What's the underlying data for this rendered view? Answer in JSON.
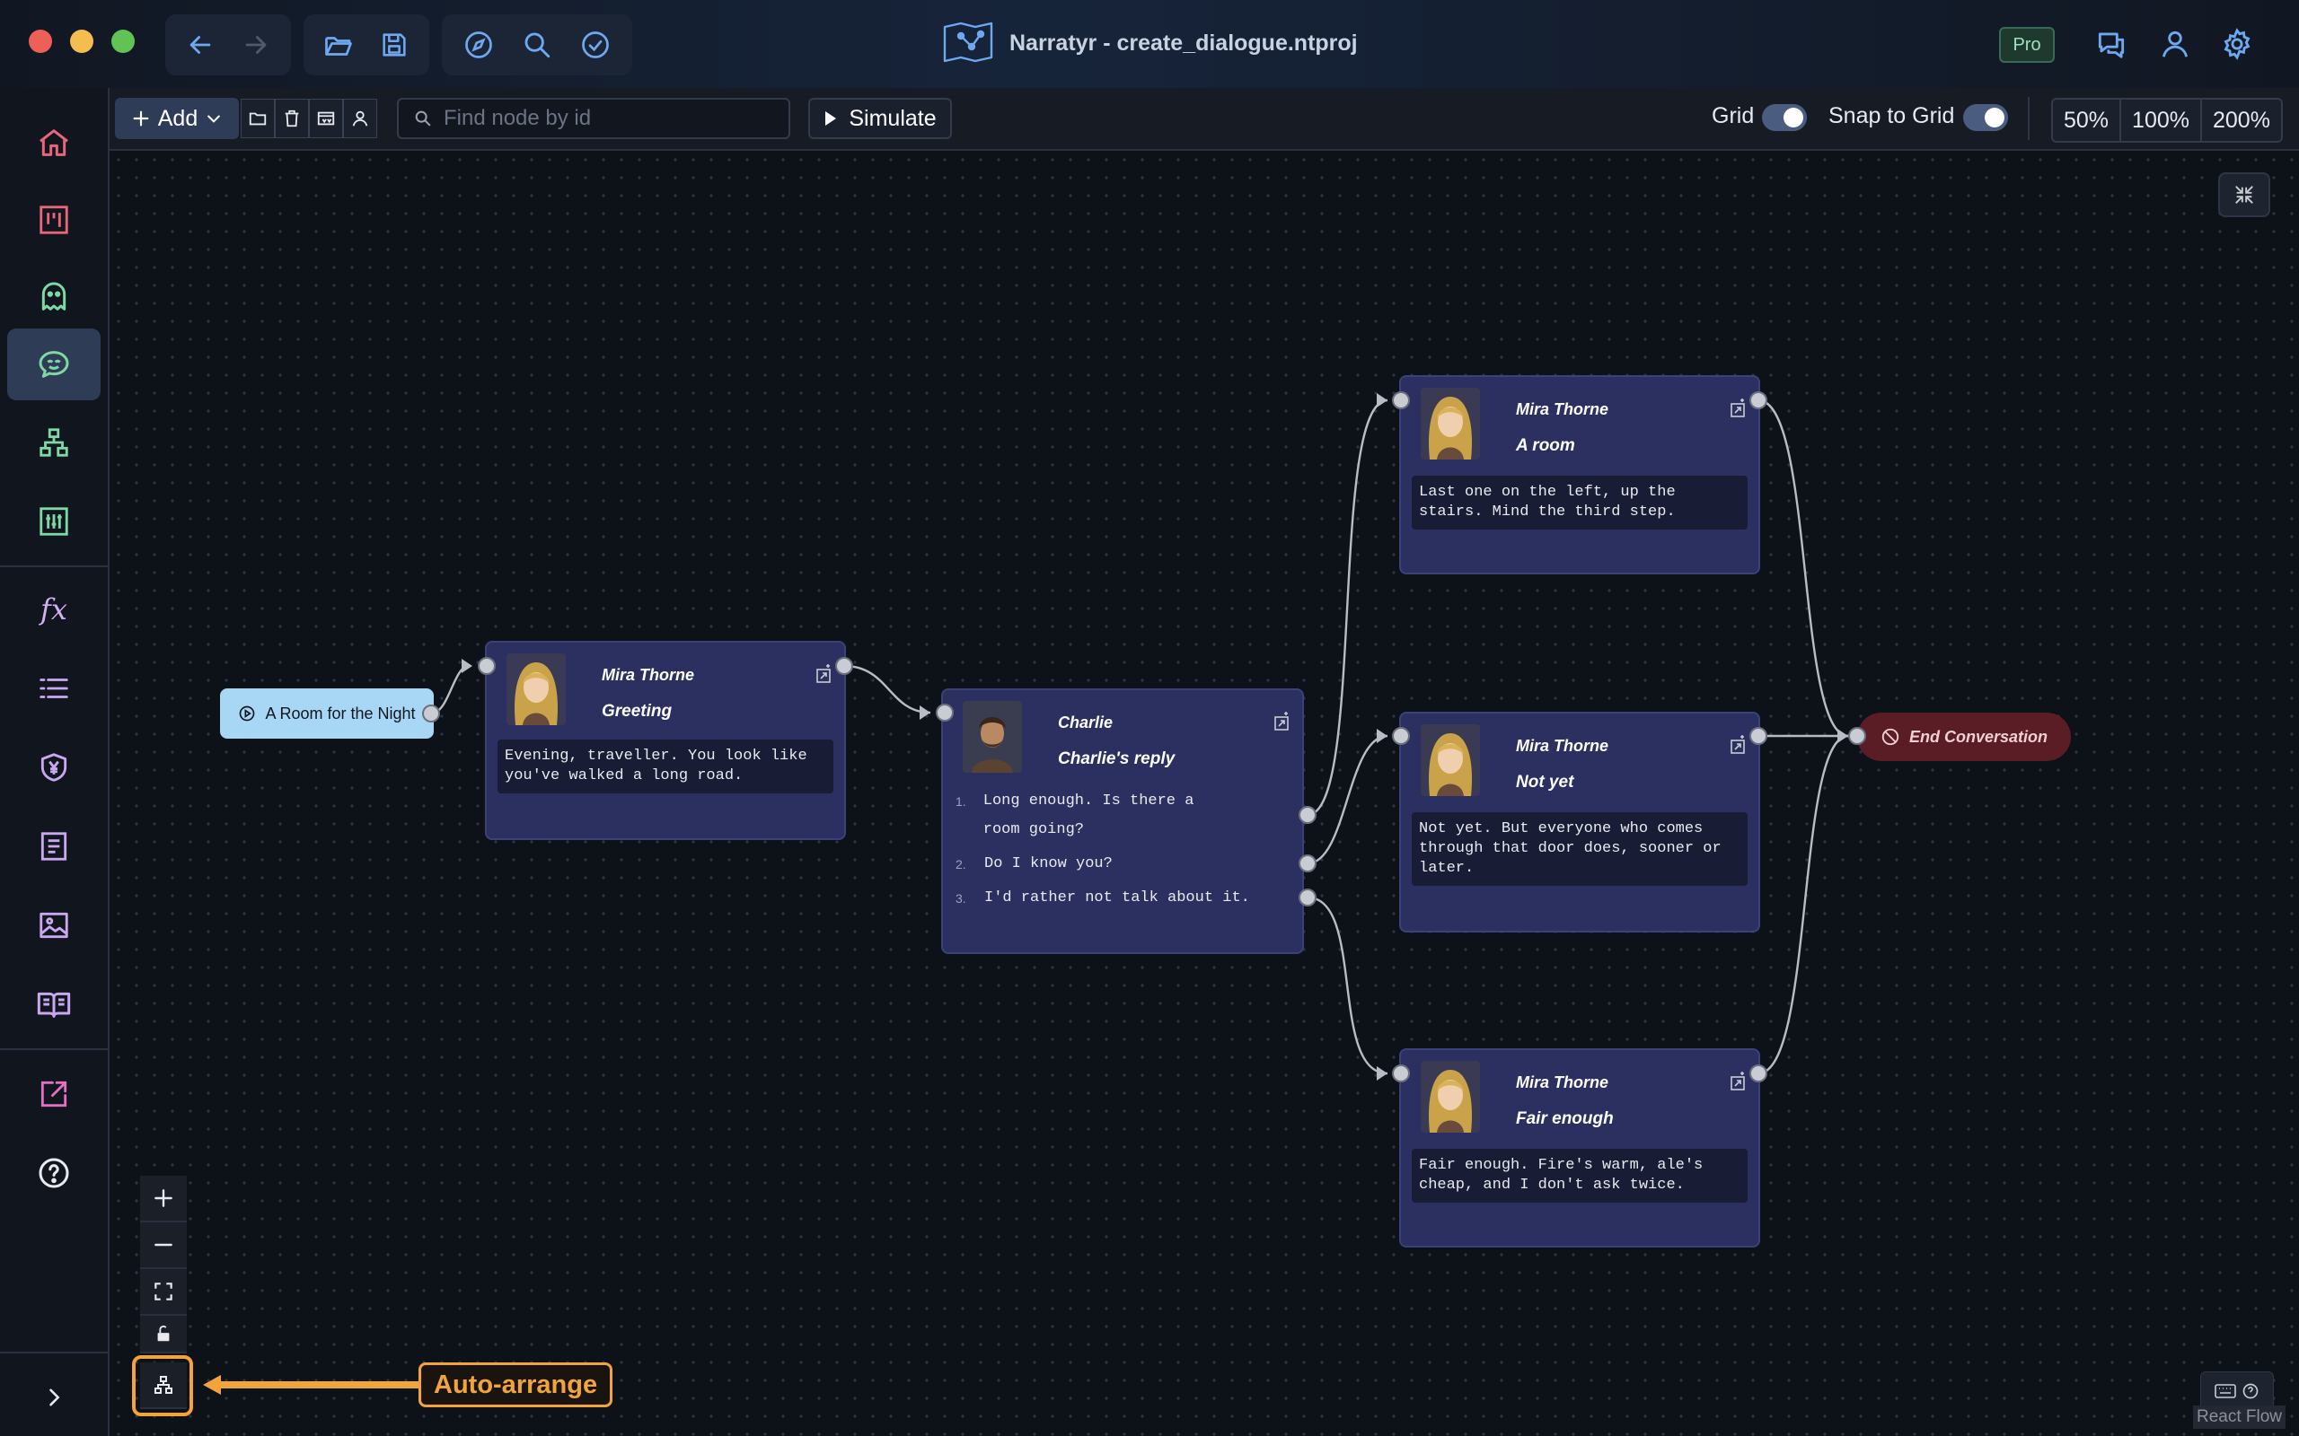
{
  "window": {
    "title": "Narratyr - create_dialogue.ntproj",
    "badge": "Pro"
  },
  "toolbar": {
    "add_label": "Add",
    "search_placeholder": "Find node by id",
    "simulate_label": "Simulate",
    "grid_label": "Grid",
    "snap_label": "Snap to Grid",
    "zoom_options": [
      "50%",
      "100%",
      "200%"
    ]
  },
  "sidebar": {
    "items": [
      "home-icon",
      "kanban-icon",
      "ghost-icon",
      "dialogue-icon",
      "hierarchy-icon",
      "sliders-icon",
      "function-icon",
      "list-icon",
      "shield-currency-icon",
      "document-icon",
      "image-icon",
      "book-icon",
      "export-icon",
      "help-icon",
      "expand-icon"
    ],
    "fx_label": "fx"
  },
  "nodes": {
    "start": {
      "label": "A Room for the Night"
    },
    "greeting": {
      "speaker": "Mira Thorne",
      "title": "Greeting",
      "text": "Evening, traveller. You look like you've walked a long road."
    },
    "reply": {
      "speaker": "Charlie",
      "title": "Charlie's reply",
      "choices": [
        {
          "num": "1.",
          "text": "Long enough. Is there a room going?"
        },
        {
          "num": "2.",
          "text": "Do I know you?"
        },
        {
          "num": "3.",
          "text": "I'd rather not talk about it."
        }
      ]
    },
    "room": {
      "speaker": "Mira Thorne",
      "title": "A room",
      "text": "Last one on the left, up the stairs. Mind the third step."
    },
    "notyet": {
      "speaker": "Mira Thorne",
      "title": "Not yet",
      "text": "Not yet. But everyone who comes through that door does, sooner or later."
    },
    "fair": {
      "speaker": "Mira Thorne",
      "title": "Fair enough",
      "text": "Fair enough. Fire's warm, ale's cheap, and I don't ask twice."
    },
    "end": {
      "label": "End Conversation"
    }
  },
  "annotation": {
    "label": "Auto-arrange",
    "color": "#f2a33a"
  },
  "footer": {
    "attribution": "React Flow"
  },
  "colors": {
    "node_bg": "#2b3060",
    "start_bg": "#a8d6f5",
    "end_bg": "#5a1c25",
    "accent": "#f2a33a"
  }
}
